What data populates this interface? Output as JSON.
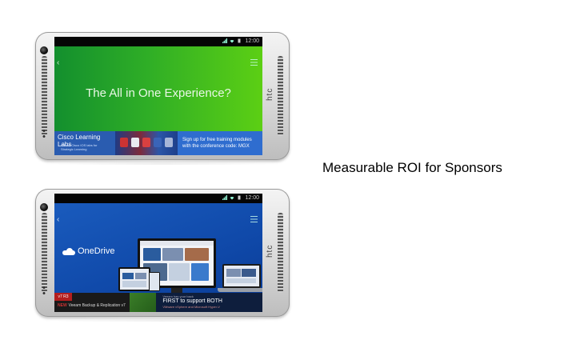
{
  "slide": {
    "caption": "Measurable ROI for Sponsors"
  },
  "phone1": {
    "brand": "htc",
    "status_time": "12:00",
    "screen_title": "The All in One Experience?",
    "banner": {
      "left_title": "Cisco Learning Labs",
      "left_subtitle": "Official Cisco IOS labs for Strategic Learning",
      "signup_line1": "Sign up for free training modules",
      "signup_line2": "with the conference code: MGX"
    },
    "colors": {
      "screen_bg": "#2fae26",
      "banner_bg": "#2f6dcf"
    }
  },
  "phone2": {
    "brand": "htc",
    "status_time": "12:00",
    "app_name": "OneDrive",
    "banner": {
      "badge": "v7 R3",
      "veeam_new": "NEW",
      "veeam_line": "Veeam Backup & Replication v7",
      "first_small": "Veeam has your back",
      "first_big": "FIRST to support BOTH",
      "first_tiny": "VMware vSphere and Microsoft Hyper-V"
    },
    "colors": {
      "screen_bg": "#0f48a8"
    }
  },
  "icons": [
    "back-chevron-icon",
    "menu-icon",
    "wifi-icon",
    "signal-icon",
    "battery-icon",
    "onedrive-cloud-icon"
  ]
}
